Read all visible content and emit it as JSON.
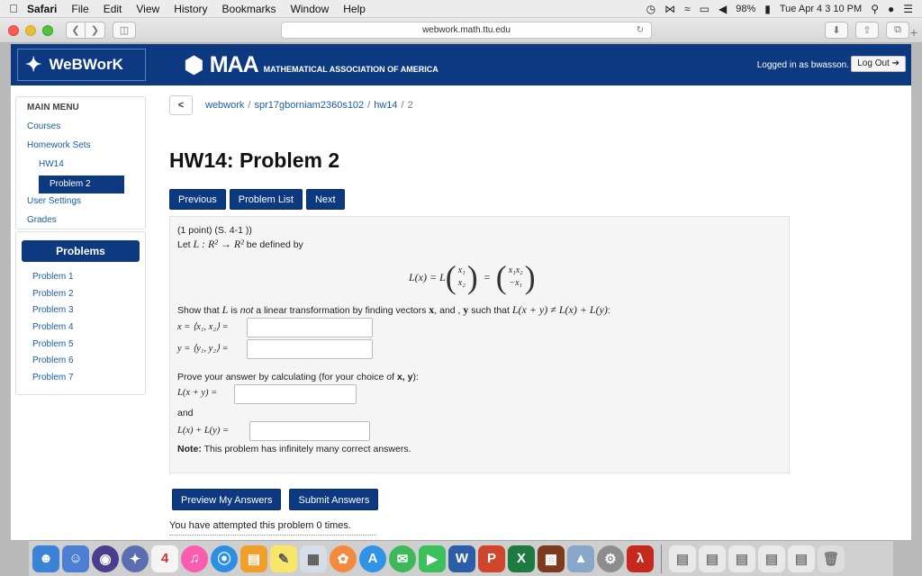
{
  "menubar": {
    "apple": "",
    "items": [
      "Safari",
      "File",
      "Edit",
      "View",
      "History",
      "Bookmarks",
      "Window",
      "Help"
    ],
    "battery": "98%",
    "clock": "Tue Apr 4  3 10 PM"
  },
  "browser": {
    "url": "webwork.math.ttu.edu"
  },
  "header": {
    "logo_text": "WeBWorK",
    "maa_text": "MAA",
    "maa_full": "MATHEMATICAL ASSOCIATION OF AMERICA",
    "login_text": "Logged in as bwasson.",
    "logout_label": "Log Out ➔"
  },
  "sidebar": {
    "title": "MAIN MENU",
    "courses": "Courses",
    "homework_sets": "Homework Sets",
    "hw": "HW14",
    "problem": "Problem 2",
    "user_settings": "User Settings",
    "grades": "Grades"
  },
  "problems_panel": {
    "title": "Problems",
    "items": [
      "Problem 1",
      "Problem 2",
      "Problem 3",
      "Problem 4",
      "Problem 5",
      "Problem 6",
      "Problem 7"
    ]
  },
  "breadcrumb": {
    "back": "<",
    "part1": "webwork",
    "part2": "spr17gborniam2360s102",
    "part3": "hw14",
    "current": "2"
  },
  "title": "HW14: Problem 2",
  "nav_buttons": {
    "previous": "Previous",
    "problem_list": "Problem List",
    "next": "Next"
  },
  "problem": {
    "points": "(1 point) (S. 4-1 ))",
    "let_a": "Let ",
    "let_math": "L : R² → R²",
    "let_b": " be defined by",
    "def_lhs": "L(x) = L",
    "vec1_top": "x₁",
    "vec1_bot": "x₂",
    "equals": "=",
    "vec2_top": "x₁x₂",
    "vec2_bot": "−x₁",
    "show_a": "Show that ",
    "show_L": "L",
    "show_b": " is ",
    "show_not": "not",
    "show_c": " a linear transformation by finding vectors ",
    "show_x": "x",
    "show_d": ", and , ",
    "show_y": "y",
    "show_e": " such that ",
    "show_math": "L(x + y) ≠ L(x) + L(y)",
    "show_f": ":",
    "x_label": "x = ⟨x₁, x₂⟩ =",
    "y_label": "y = ⟨y₁, y₂⟩ =",
    "prove_a": "Prove your answer by calculating (for your choice of ",
    "prove_xy": "x, y",
    "prove_b": "):",
    "lxy_label": "L(x + y) =",
    "and": "and",
    "lx_ly_label": "L(x) + L(y) =",
    "note_bold": "Note:",
    "note_text": " This problem has infinitely many correct answers."
  },
  "actions": {
    "preview": "Preview My Answers",
    "submit": "Submit Answers"
  },
  "attempt_text": "You have attempted this problem 0 times."
}
